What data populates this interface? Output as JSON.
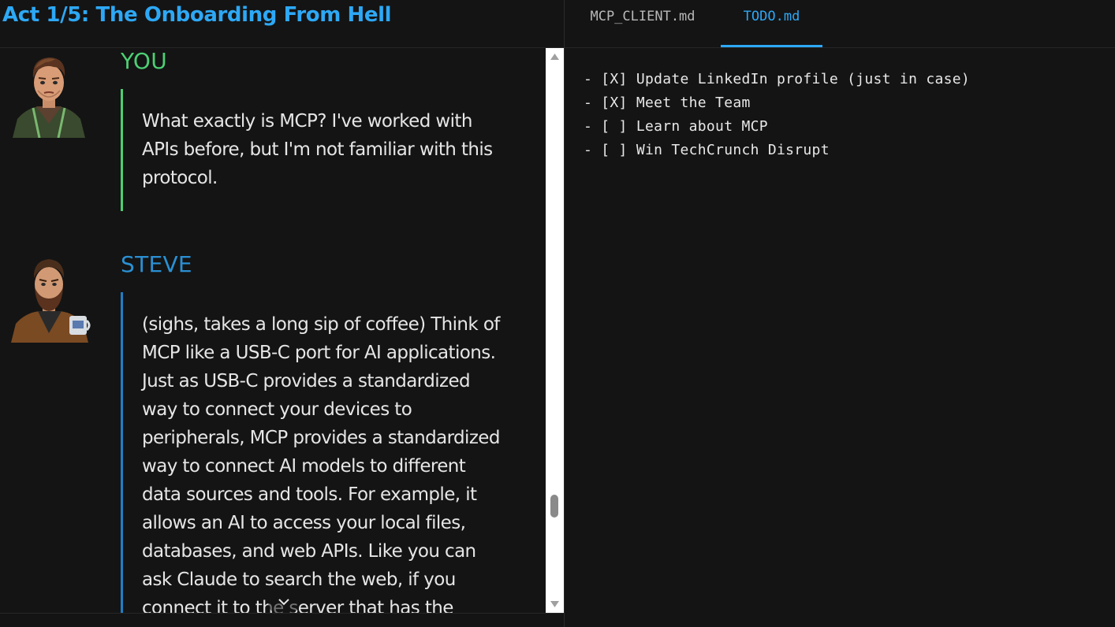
{
  "act": {
    "title": "Act 1/5: The Onboarding From Hell"
  },
  "chat": {
    "messages": [
      {
        "speaker": "YOU",
        "text": "What exactly is MCP? I've worked with APIs before, but I'm not familiar with this protocol."
      },
      {
        "speaker": "STEVE",
        "text": "(sighs, takes a long sip of coffee) Think of MCP like a USB-C port for AI applications. Just as USB-C provides a standardized way to connect your devices to peripherals, MCP provides a standardized way to connect AI models to different data sources and tools. For example, it allows an AI to access your local files, databases, and web APIs. Like you can ask Claude to search the web, if you connect it to the server that has the"
      }
    ]
  },
  "tabs": [
    {
      "label": "MCP_CLIENT.md",
      "active": false
    },
    {
      "label": "TODO.md",
      "active": true
    }
  ],
  "todo": {
    "lines": [
      "- [X] Update LinkedIn profile (just in case)",
      "- [X] Meet the Team",
      "- [ ] Learn about MCP",
      "- [ ] Win TechCrunch Disrupt"
    ]
  },
  "colors": {
    "accent_blue": "#2da8f5",
    "you_green": "#4ccf73",
    "steve_blue": "#2a90d4",
    "background": "#141414"
  },
  "icons": {
    "scroll_down": "chevron-down-icon",
    "scroll_up_arrow": "triangle-up-icon",
    "scroll_down_arrow": "triangle-down-icon"
  }
}
